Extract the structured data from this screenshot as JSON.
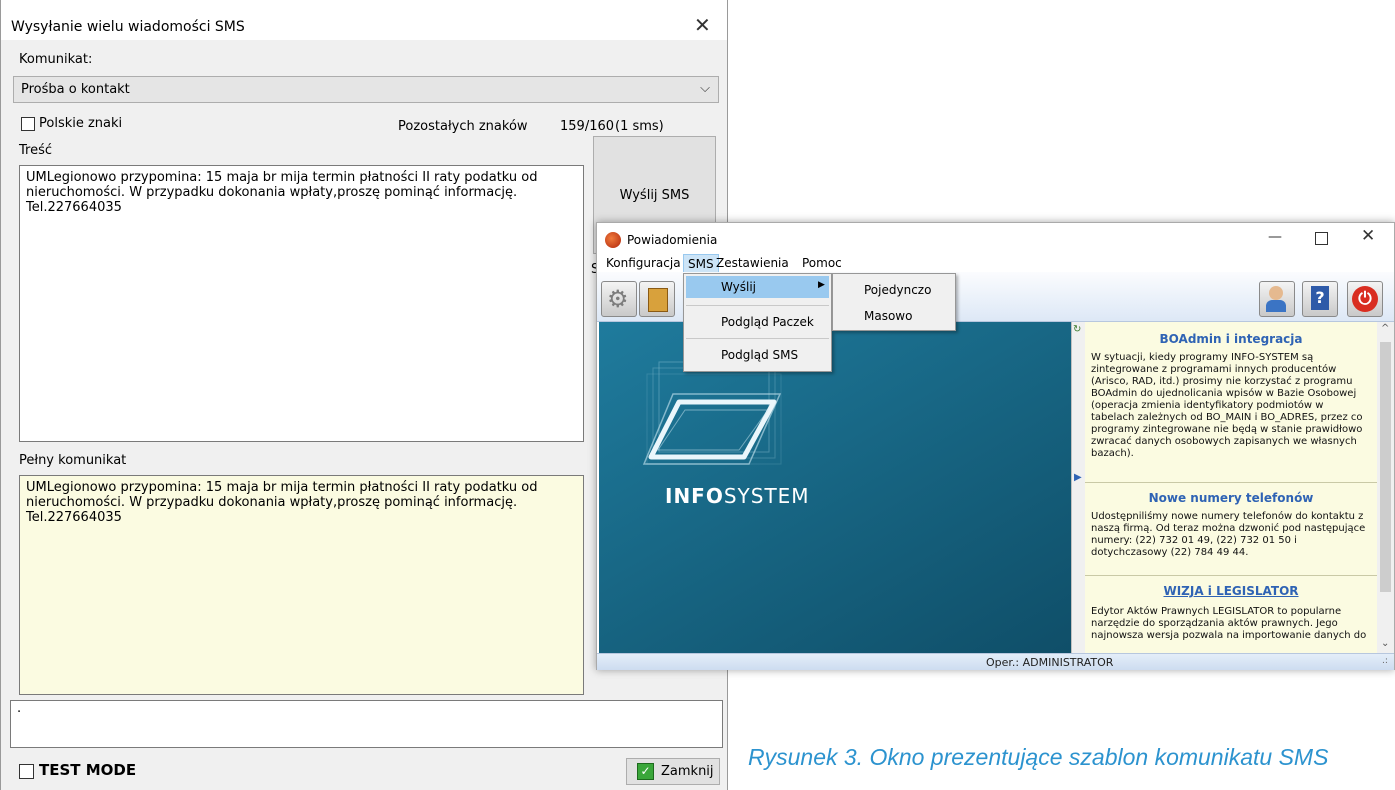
{
  "sms_dialog": {
    "title": "Wysyłanie wielu wiadomości SMS",
    "komunikat_label": "Komunikat:",
    "komunikat_value": "Prośba o kontakt",
    "polskie_znaki_label": "Polskie znaki",
    "remaining_label": "Pozostałych znaków",
    "remaining_value": "159/160",
    "sms_count": "(1 sms)",
    "tresc_label": "Treść",
    "tresc_text": "UMLegionowo przypomina: 15 maja br mija termin płatności II raty podatku od\nnieruchomości. W przypadku dokonania wpłaty,proszę pominąć informację.\nTel.227664035",
    "send_button": "Wyślij SMS",
    "partial_label": "S",
    "pelny_label": "Pełny komunikat",
    "pelny_text": "UMLegionowo przypomina: 15 maja br mija termin płatności II raty podatku od\nnieruchomości. W przypadku dokonania wpłaty,proszę pominąć informację.\nTel.227664035",
    "log_text": "·",
    "test_mode_label": "TEST MODE",
    "close_button": "Zamknij"
  },
  "notif_window": {
    "title": "Powiadomienia",
    "menu": [
      "Konfiguracja",
      "SMS",
      "Zestawienia",
      "Pomoc"
    ],
    "sms_menu": [
      "Wyślij",
      "Podgląd Paczek",
      "Podgląd SMS"
    ],
    "submenu": [
      "Pojedynczo",
      "Masowo"
    ],
    "logo_bold": "INFO",
    "logo_light": "SYSTEM",
    "news": [
      {
        "title": "BOAdmin i integracja",
        "body": "W sytuacji, kiedy programy INFO-SYSTEM są zintegrowane z programami innych producentów (Arisco, RAD, itd.) prosimy nie korzystać z programu BOAdmin do ujednolicania wpisów w Bazie Osobowej (operacja zmienia identyfikatory podmiotów w tabelach zależnych od BO_MAIN i BO_ADRES, przez co programy zintegrowane nie będą w stanie prawidłowo zwracać danych osobowych zapisanych we własnych bazach)."
      },
      {
        "title": "Nowe numery telefonów",
        "body": "Udostępniliśmy nowe numery telefonów do kontaktu z naszą firmą. Od teraz można dzwonić pod następujące numery: (22) 732 01 49, (22) 732 01 50 i dotychczasowy (22) 784 49 44."
      },
      {
        "title": "WIZJA i LEGISLATOR",
        "body": "Edytor Aktów Prawnych LEGISLATOR to popularne narzędzie do sporządzania aktów prawnych. Jego najnowsza wersja pozwala na importowanie danych do"
      }
    ],
    "status": "Oper.: ADMINISTRATOR"
  },
  "caption": "Rysunek 3. Okno prezentujące szablon komunikatu SMS",
  "colors": {
    "accent": "#2c93cf",
    "yellow_bg": "#fbfbe1",
    "blue_panel": "#1d6d8e",
    "news_bg": "#fbfbe1",
    "menu_highlight": "#99c9ef"
  }
}
